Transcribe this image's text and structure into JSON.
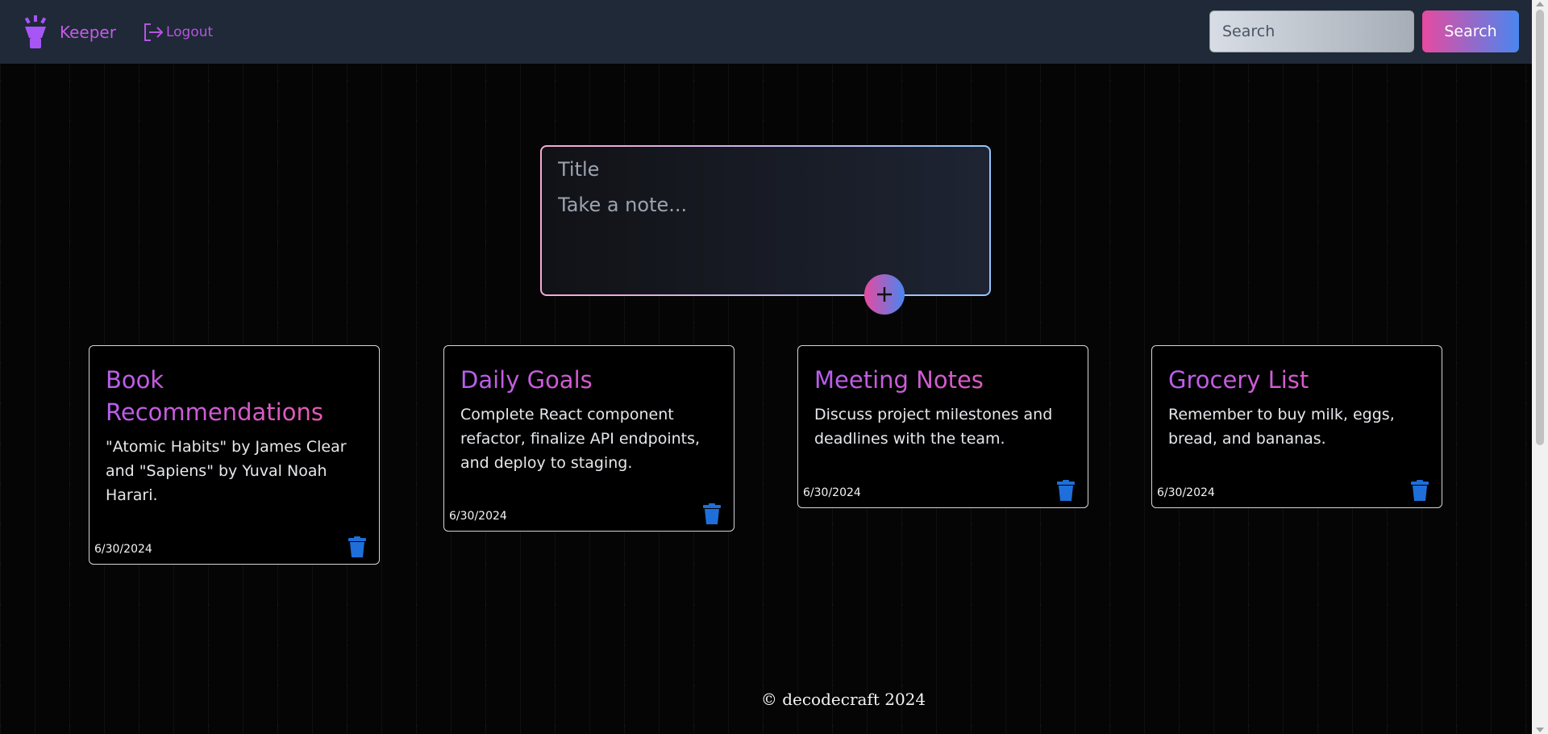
{
  "header": {
    "brand": "Keeper",
    "logout_label": "Logout",
    "search_placeholder": "Search",
    "search_button": "Search"
  },
  "composer": {
    "title_placeholder": "Title",
    "body_placeholder": "Take a note...",
    "add_icon": "plus-icon"
  },
  "notes": [
    {
      "title": "Book Recommendations",
      "content": "\"Atomic Habits\" by James Clear and \"Sapiens\" by Yuval Noah Harari.",
      "date": "6/30/2024"
    },
    {
      "title": "Daily Goals",
      "content": "Complete React component refactor, finalize API endpoints, and deploy to staging.",
      "date": "6/30/2024"
    },
    {
      "title": "Meeting Notes",
      "content": "Discuss project milestones and deadlines with the team.",
      "date": "6/30/2024"
    },
    {
      "title": "Grocery List",
      "content": "Remember to buy milk, eggs, bread, and bananas.",
      "date": "6/30/2024"
    }
  ],
  "footer": {
    "text": "© decodecraft 2024"
  },
  "colors": {
    "accent_pink": "#e64aa0",
    "accent_blue": "#4a86ef",
    "brand_purple": "#c45ae8",
    "delete_blue": "#1e6fd9"
  }
}
